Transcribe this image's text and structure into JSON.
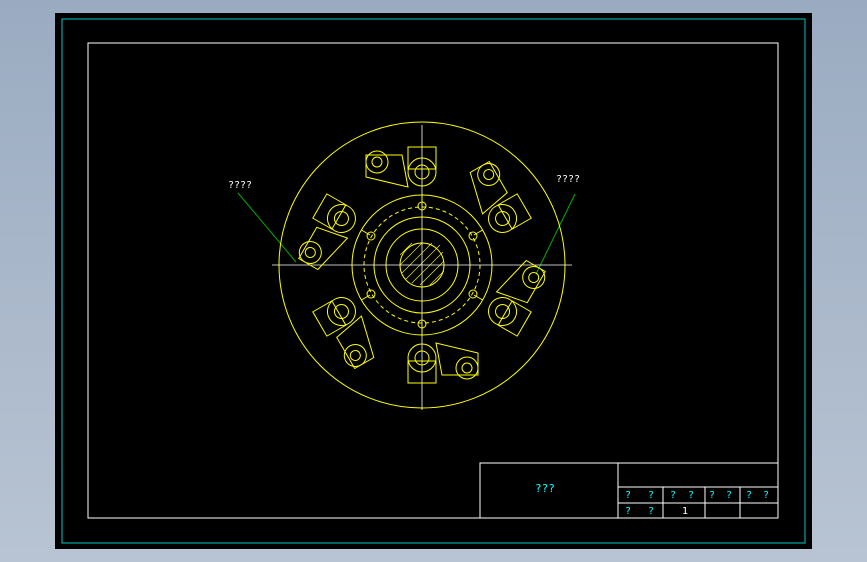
{
  "labels": {
    "left_callout": "????",
    "right_callout": "????"
  },
  "title_block": {
    "title": "???",
    "row1": [
      "?",
      "?",
      "?",
      "?",
      "?",
      "?",
      "?",
      "?"
    ],
    "row2": [
      "?",
      "?",
      "1"
    ]
  },
  "colors": {
    "frame": "#00c8c8",
    "drawing": "#ffff00",
    "leader": "#00b000",
    "text": "#ffffff",
    "canvas": "#000000"
  }
}
